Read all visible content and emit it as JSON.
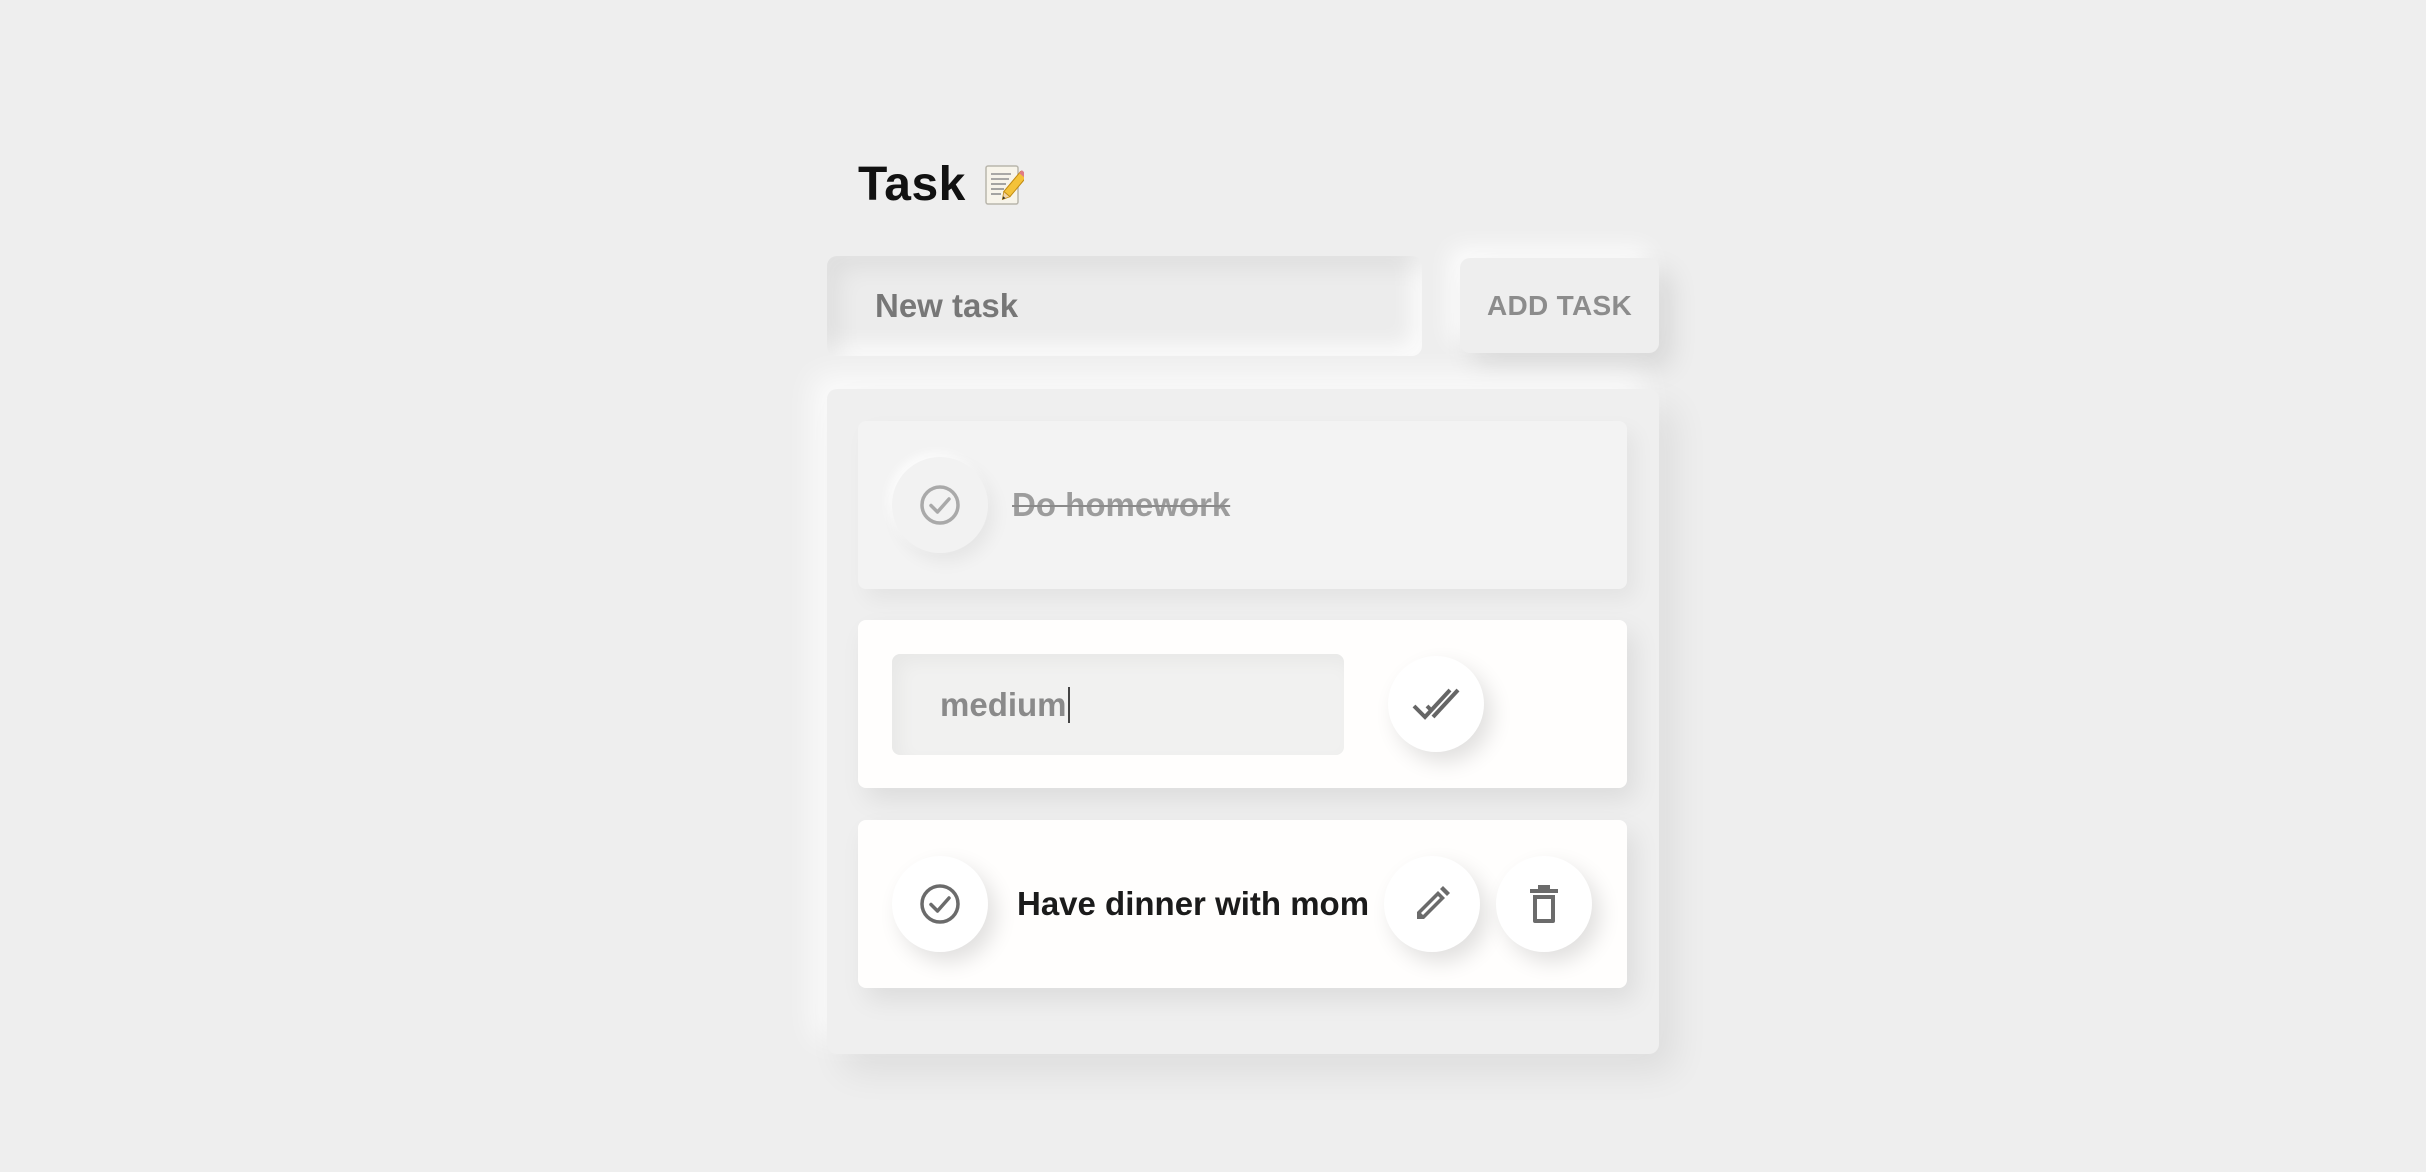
{
  "header": {
    "title": "Task",
    "title_icon": "memo-icon"
  },
  "new_task": {
    "placeholder": "New task",
    "value": "",
    "add_label": "ADD TASK"
  },
  "tasks": [
    {
      "text": "Do homework",
      "completed": true,
      "editing": false,
      "check_icon": "check-circle-icon"
    },
    {
      "text": "medium",
      "completed": false,
      "editing": true,
      "save_icon": "double-check-icon"
    },
    {
      "text": "Have dinner with mom",
      "completed": false,
      "editing": false,
      "check_icon": "check-circle-icon",
      "edit_icon": "pencil-icon",
      "delete_icon": "trash-icon"
    }
  ],
  "colors": {
    "background": "#eeeeee",
    "card": "#fffefd",
    "done_card": "#f3f3f3",
    "text_primary": "#1b1b1b",
    "text_muted": "#9c9c9c",
    "icon": "#6b6b6b"
  }
}
